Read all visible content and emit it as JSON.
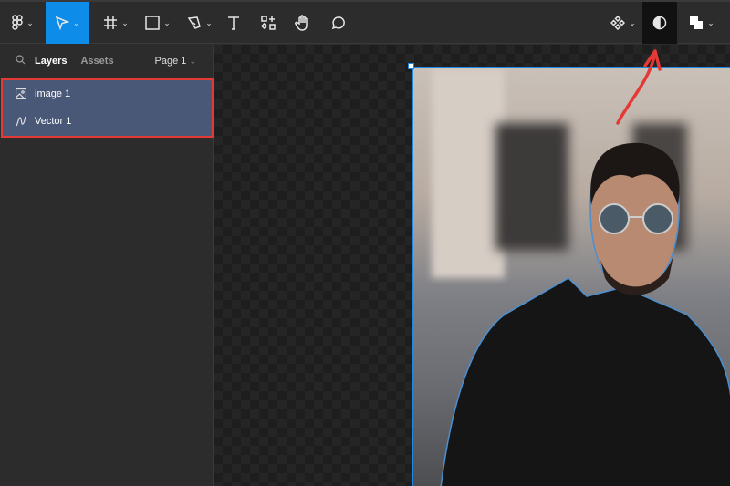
{
  "toolbar": {
    "tools": [
      "figma-menu",
      "move",
      "frame",
      "shape",
      "pen",
      "text",
      "resources",
      "hand",
      "comment"
    ],
    "right": [
      "components",
      "contrast",
      "boolean"
    ]
  },
  "panel": {
    "tabs": {
      "layers": "Layers",
      "assets": "Assets"
    },
    "page": "Page 1",
    "layers": [
      {
        "name": "image 1",
        "type": "image"
      },
      {
        "name": "Vector 1",
        "type": "vector"
      }
    ]
  },
  "colors": {
    "accent": "#0d8ce9",
    "selection": "#4a5878",
    "highlight": "#e53935"
  }
}
